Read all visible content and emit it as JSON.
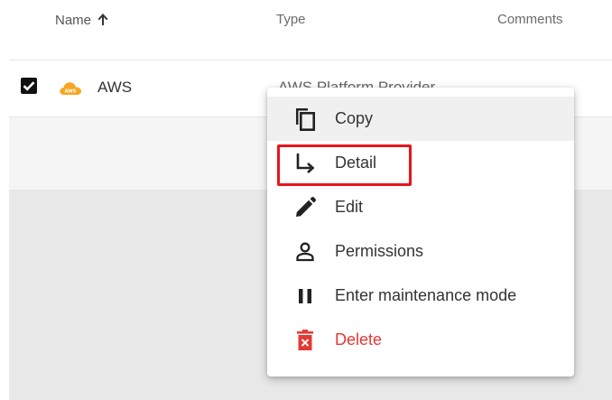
{
  "table": {
    "columns": {
      "name": "Name",
      "type": "Type",
      "comments": "Comments"
    },
    "sort": {
      "column": "name",
      "direction": "ascending"
    },
    "rows": [
      {
        "name": "AWS",
        "type": "AWS Platform Provider",
        "selected": true,
        "icon": "aws-cloud-icon"
      }
    ]
  },
  "context_menu": {
    "items": [
      {
        "label": "Copy",
        "icon": "copy-icon"
      },
      {
        "label": "Detail",
        "icon": "arrow-turn-right-icon"
      },
      {
        "label": "Edit",
        "icon": "pencil-icon"
      },
      {
        "label": "Permissions",
        "icon": "person-icon"
      },
      {
        "label": "Enter maintenance mode",
        "icon": "pause-icon"
      },
      {
        "label": "Delete",
        "icon": "trash-icon"
      }
    ]
  },
  "colors": {
    "danger": "#e53935",
    "aws_orange": "#f5a623",
    "highlight": "#e8151b"
  }
}
